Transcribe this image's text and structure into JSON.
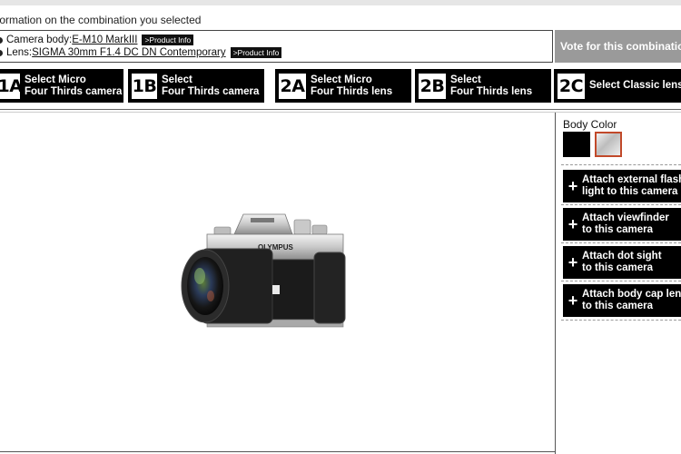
{
  "header": {
    "info_title": "formation on the combination you selected"
  },
  "selection": {
    "camera_prefix": "Camera body: ",
    "camera_name": "E-M10 MarkIII",
    "lens_prefix": "Lens: ",
    "lens_name": "SIGMA 30mm F1.4 DC DN Contemporary",
    "product_info_label": ">Product Info"
  },
  "vote_label": "Vote for this combinatio",
  "steps": [
    {
      "badge": "1A",
      "line1": "Select Micro",
      "line2": "Four Thirds camera"
    },
    {
      "badge": "1B",
      "line1": "Select",
      "line2": "Four Thirds camera"
    },
    {
      "badge": "2A",
      "line1": "Select Micro",
      "line2": "Four Thirds lens"
    },
    {
      "badge": "2B",
      "line1": "Select",
      "line2": "Four Thirds lens"
    },
    {
      "badge": "2C",
      "line1": "Select Classic lens",
      "line2": ""
    }
  ],
  "preview": {
    "brand_text": "OLYMPUS"
  },
  "body_color": {
    "label": "Body Color",
    "options": [
      "black",
      "silver"
    ],
    "selected": "silver"
  },
  "accessories": [
    {
      "line1": "Attach external flash/",
      "line2": "light to this camera"
    },
    {
      "line1": "Attach viewfinder",
      "line2": "to this camera"
    },
    {
      "line1": "Attach dot sight",
      "line2": "to this camera"
    },
    {
      "line1": "Attach body cap lens",
      "line2": "to this camera"
    }
  ],
  "colors": {
    "step_bg": "#000000",
    "vote_bg": "#9a9a9a",
    "selected_swatch_border": "#c1492a"
  },
  "icons": [
    "bullet-icon",
    "plus-icon"
  ]
}
